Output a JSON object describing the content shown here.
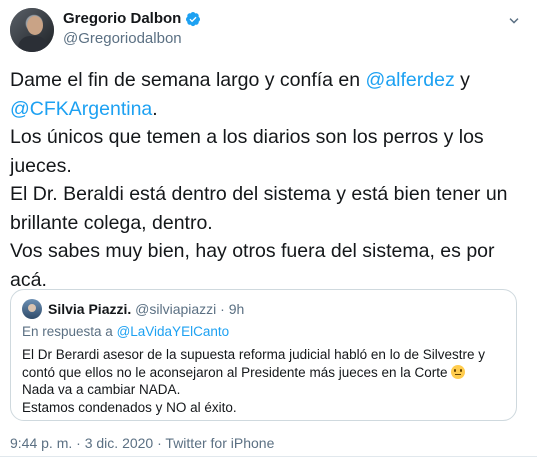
{
  "author": {
    "name": "Gregorio Dalbon",
    "handle": "@Gregoriodalbon"
  },
  "tweet": {
    "line1_pre": "Dame el fin de semana largo y confía en ",
    "mention1": "@alferdez",
    "line1_post": " y",
    "mention2": "@CFKArgentina",
    "mention2_post": ".",
    "line2": "Los únicos que temen a los diarios son los perros y los jueces.",
    "line3": "El Dr. Beraldi está dentro del sistema y está bien tener un brillante colega, dentro.",
    "line4": "Vos sabes muy bien, hay otros fuera del sistema, es por acá."
  },
  "quoted": {
    "name": "Silvia Piazzi.",
    "handle": "@silviapiazzi",
    "separator": "·",
    "time": "9h",
    "reply_prefix": "En respuesta a ",
    "reply_to": "@LaVidaYElCanto",
    "body_line1": "El Dr Berardi asesor de la supuesta reforma judicial habló en lo de Silvestre y contó que ellos no le aconsejaron al Presidente más jueces en la Corte",
    "body_line2": "Nada va a cambiar NADA.",
    "body_line3": "Estamos condenados y NO al éxito."
  },
  "footer": {
    "time": "9:44 p. m.",
    "sep1": " · ",
    "date": "3 dic. 2020",
    "sep2": " · ",
    "source": "Twitter for iPhone"
  },
  "colors": {
    "link": "#1da1f2",
    "verified": "#1da1f2",
    "secondary_text": "#5b7083",
    "border": "#cfd9de"
  },
  "icons": [
    "verified-badge-icon",
    "chevron-down-icon",
    "slightly-smiling-face-emoji"
  ]
}
